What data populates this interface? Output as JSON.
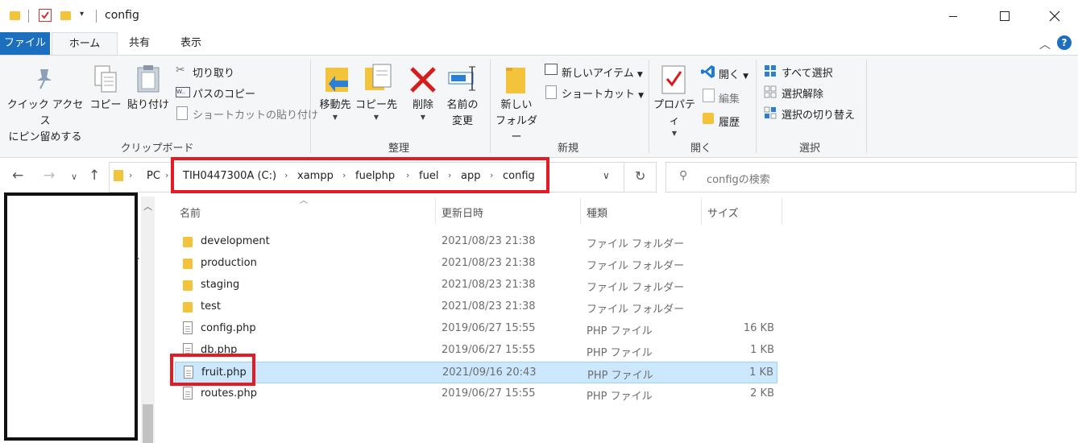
{
  "window": {
    "title": "config",
    "minimize_icon": "minimize-icon",
    "maximize_icon": "maximize-icon",
    "close_icon": "close-icon"
  },
  "ribbon_tabs": [
    "ファイル",
    "ホーム",
    "共有",
    "表示"
  ],
  "ribbon": {
    "clipboard": {
      "pin_label_1": "クイック アクセス",
      "pin_label_2": "にピン留めする",
      "copy": "コピー",
      "paste": "貼り付け",
      "cut": "切り取り",
      "copy_path": "パスのコピー",
      "paste_shortcut": "ショートカットの貼り付け",
      "group": "クリップボード"
    },
    "organize": {
      "move_to": "移動先",
      "copy_to": "コピー先",
      "delete": "削除",
      "rename_1": "名前の",
      "rename_2": "変更",
      "group": "整理"
    },
    "new": {
      "new_folder_1": "新しい",
      "new_folder_2": "フォルダー",
      "new_item": "新しいアイテム",
      "shortcut": "ショートカット",
      "group": "新規"
    },
    "open": {
      "properties": "プロパティ",
      "open": "開く",
      "edit": "編集",
      "history": "履歴",
      "group": "開く"
    },
    "select": {
      "select_all": "すべて選択",
      "select_none": "選択解除",
      "invert": "選択の切り替え",
      "group": "選択"
    }
  },
  "address": {
    "root": "PC",
    "crumbs": [
      "TIH0447300A (C:)",
      "xampp",
      "fuelphp",
      "fuel",
      "app",
      "config"
    ]
  },
  "search": {
    "placeholder": "configの検索"
  },
  "columns": [
    "名前",
    "更新日時",
    "種類",
    "サイズ"
  ],
  "files": [
    {
      "name": "development",
      "date": "2021/08/23 21:38",
      "type": "ファイル フォルダー",
      "size": "",
      "kind": "folder"
    },
    {
      "name": "production",
      "date": "2021/08/23 21:38",
      "type": "ファイル フォルダー",
      "size": "",
      "kind": "folder"
    },
    {
      "name": "staging",
      "date": "2021/08/23 21:38",
      "type": "ファイル フォルダー",
      "size": "",
      "kind": "folder"
    },
    {
      "name": "test",
      "date": "2021/08/23 21:38",
      "type": "ファイル フォルダー",
      "size": "",
      "kind": "folder"
    },
    {
      "name": "config.php",
      "date": "2019/06/27 15:55",
      "type": "PHP ファイル",
      "size": "16 KB",
      "kind": "file"
    },
    {
      "name": "db.php",
      "date": "2019/06/27 15:55",
      "type": "PHP ファイル",
      "size": "1 KB",
      "kind": "file"
    },
    {
      "name": "fruit.php",
      "date": "2021/09/16 20:43",
      "type": "PHP ファイル",
      "size": "1 KB",
      "kind": "file",
      "selected": true
    },
    {
      "name": "routes.php",
      "date": "2019/06/27 15:55",
      "type": "PHP ファイル",
      "size": "2 KB",
      "kind": "file"
    }
  ],
  "colors": {
    "file_tab": "#1c6fbf",
    "highlight_box": "#e21b24",
    "selected_row": "#cce8ff",
    "folder": "#f3c33b"
  }
}
